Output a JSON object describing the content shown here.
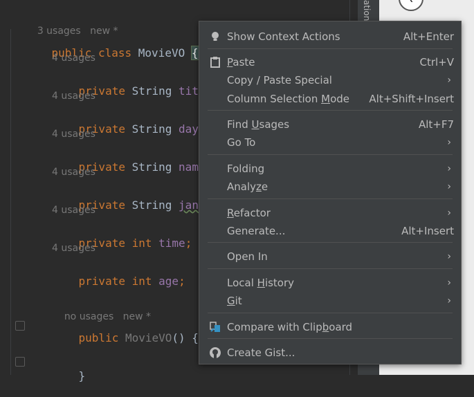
{
  "editor": {
    "header_hint": {
      "usages": "3 usages",
      "status": "new *"
    },
    "class_decl": {
      "kw1": "public",
      "kw2": "class",
      "name": "MovieVO",
      "brace": "{"
    },
    "fields": [
      {
        "hint": "4 usages",
        "kw": "private",
        "type": "String",
        "name": "title",
        "end": ";"
      },
      {
        "hint": "4 usages",
        "kw": "private",
        "type": "String",
        "name": "day",
        "end": ";"
      },
      {
        "hint": "4 usages",
        "kw": "private",
        "type": "String",
        "name": "name",
        "end": ";"
      },
      {
        "hint": "4 usages",
        "kw": "private",
        "type": "String",
        "name": "jangre",
        "end": ""
      },
      {
        "hint": "4 usages",
        "kw": "private",
        "type": "int",
        "name": "time",
        "end": ";"
      },
      {
        "hint": "4 usages",
        "kw": "private",
        "type": "int",
        "name": "age",
        "end": ";"
      }
    ],
    "ctor_hint": {
      "usages": "no usages",
      "status": "new *"
    },
    "ctor": {
      "kw": "public",
      "name": "MovieVO",
      "sig": "() {"
    },
    "close_brace": "}"
  },
  "side_tab": {
    "label": "ation"
  },
  "menu": {
    "show_context_actions": {
      "label": "Show Context Actions",
      "shortcut": "Alt+Enter"
    },
    "paste": {
      "pre": "",
      "mn": "P",
      "post": "aste",
      "shortcut": "Ctrl+V"
    },
    "copy_paste_special": {
      "label": "Copy / Paste Special"
    },
    "column_selection": {
      "pre": "Column Selection ",
      "mn": "M",
      "post": "ode",
      "shortcut": "Alt+Shift+Insert"
    },
    "find_usages": {
      "pre": "Find ",
      "mn": "U",
      "post": "sages",
      "shortcut": "Alt+F7"
    },
    "go_to": {
      "label": "Go To"
    },
    "folding": {
      "label": "Folding"
    },
    "analyze": {
      "pre": "Analy",
      "mn": "z",
      "post": "e"
    },
    "refactor": {
      "pre": "",
      "mn": "R",
      "post": "efactor"
    },
    "generate": {
      "label": "Generate...",
      "shortcut": "Alt+Insert"
    },
    "open_in": {
      "label": "Open In"
    },
    "local_history": {
      "pre": "Local ",
      "mn": "H",
      "post": "istory"
    },
    "git": {
      "pre": "",
      "mn": "G",
      "post": "it"
    },
    "compare_clipboard": {
      "pre": "Compare with Clip",
      "mn": "b",
      "post": "oard"
    },
    "create_gist": {
      "label": "Create Gist..."
    }
  },
  "colors": {
    "keyword": "#cc7832",
    "field": "#9876aa",
    "text": "#a9b7c6",
    "menu_bg": "#3c3f41",
    "editor_bg": "#2b2b2b"
  },
  "icons": [
    "bulb-icon",
    "clipboard-icon",
    "chevron-right-icon",
    "compare-icon",
    "github-icon"
  ]
}
